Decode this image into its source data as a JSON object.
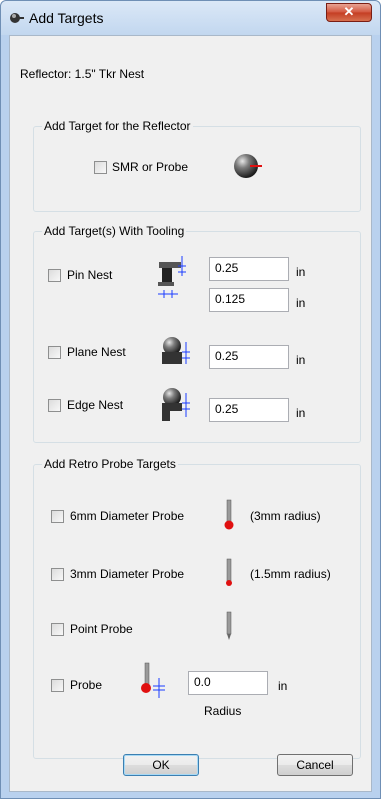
{
  "window": {
    "title": "Add Targets",
    "close_glyph": "✕"
  },
  "reflector_label": "Reflector: 1.5\" Tkr Nest",
  "reflector_group": {
    "title": "Add Target for the Reflector",
    "smr_label": "SMR or Probe",
    "smr_checked": false
  },
  "tooling_group": {
    "title": "Add Target(s) With Tooling",
    "pin_nest": {
      "label": "Pin Nest",
      "checked": false,
      "value1": "0.25",
      "unit1": "in",
      "value2": "0.125",
      "unit2": "in"
    },
    "plane_nest": {
      "label": "Plane Nest",
      "checked": false,
      "value": "0.25",
      "unit": "in"
    },
    "edge_nest": {
      "label": "Edge Nest",
      "checked": false,
      "value": "0.25",
      "unit": "in"
    }
  },
  "retro_group": {
    "title": "Add Retro Probe Targets",
    "probe6": {
      "label": "6mm Diameter Probe",
      "checked": false,
      "note": "(3mm radius)"
    },
    "probe3": {
      "label": "3mm Diameter Probe",
      "checked": false,
      "note": "(1.5mm radius)"
    },
    "point_probe": {
      "label": "Point Probe",
      "checked": false
    },
    "probe": {
      "label": "Probe",
      "checked": false,
      "value": "0.0",
      "unit": "in",
      "caption": "Radius"
    }
  },
  "buttons": {
    "ok": "OK",
    "cancel": "Cancel"
  },
  "colors": {
    "accent": "#3c7fb1",
    "probe_tip": "#e01010",
    "dimension": "#1a3cff"
  }
}
